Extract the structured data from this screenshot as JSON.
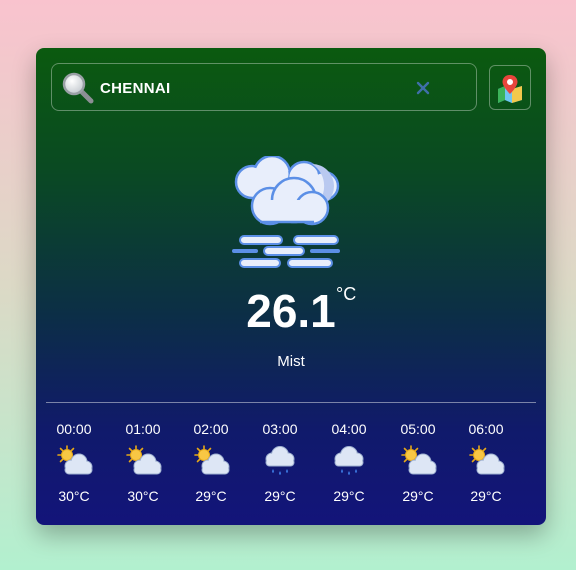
{
  "search": {
    "value": "CHENNAI",
    "icon": "search-icon",
    "clear_icon": "close-icon"
  },
  "map_button": {
    "icon": "map-pin-icon"
  },
  "current": {
    "temperature": "26.1",
    "unit": "°C",
    "condition": "Mist",
    "icon": "mist-icon"
  },
  "hourly": [
    {
      "time": "00:00",
      "temp": "30°C",
      "icon": "partly-cloudy-icon"
    },
    {
      "time": "01:00",
      "temp": "30°C",
      "icon": "partly-cloudy-icon"
    },
    {
      "time": "02:00",
      "temp": "29°C",
      "icon": "partly-cloudy-icon"
    },
    {
      "time": "03:00",
      "temp": "29°C",
      "icon": "rain-cloud-icon"
    },
    {
      "time": "04:00",
      "temp": "29°C",
      "icon": "rain-cloud-icon"
    },
    {
      "time": "05:00",
      "temp": "29°C",
      "icon": "partly-cloudy-icon"
    },
    {
      "time": "06:00",
      "temp": "29°C",
      "icon": "partly-cloudy-icon"
    }
  ],
  "colors": {
    "page_top": "#f9c3ce",
    "page_bottom": "#b2f0cf",
    "card_top": "#0b5a0f",
    "card_bottom": "#13147a",
    "clear_icon": "#3f6fa8"
  }
}
